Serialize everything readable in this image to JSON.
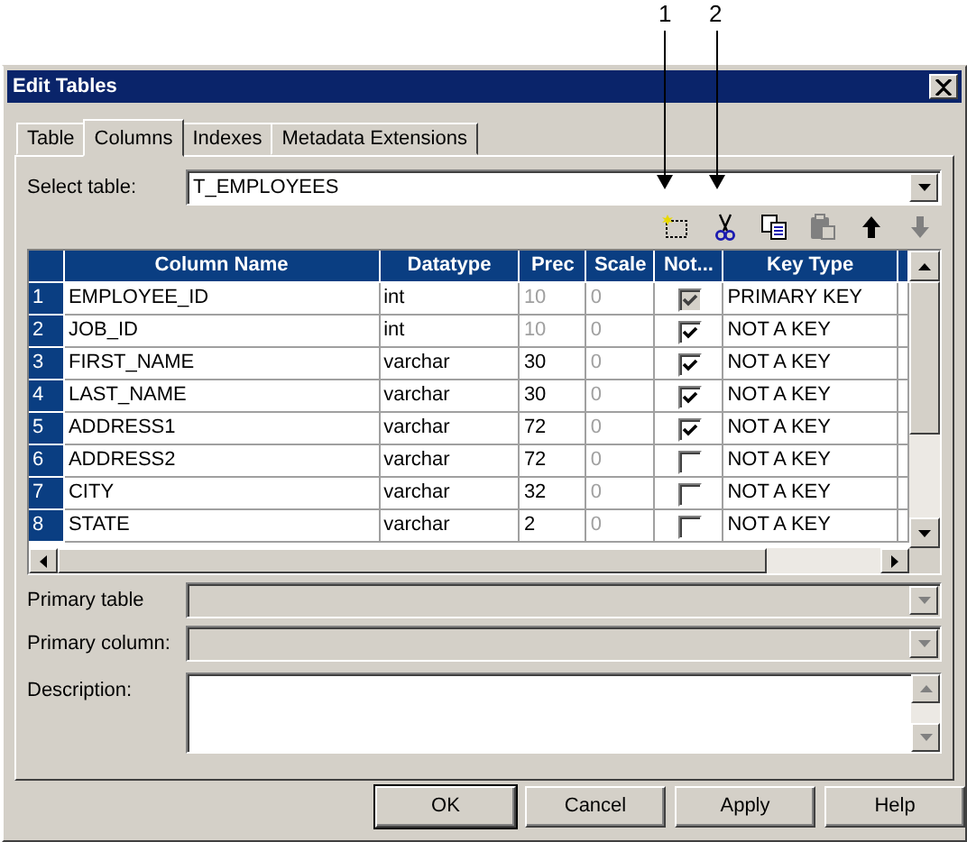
{
  "callouts": [
    {
      "label": "1"
    },
    {
      "label": "2"
    }
  ],
  "window": {
    "title": "Edit Tables"
  },
  "tabs": [
    {
      "label": "Table",
      "selected": false
    },
    {
      "label": "Columns",
      "selected": true
    },
    {
      "label": "Indexes",
      "selected": false
    },
    {
      "label": "Metadata Extensions",
      "selected": false
    }
  ],
  "select_table": {
    "label": "Select table:",
    "value": "T_EMPLOYEES"
  },
  "toolbar": [
    {
      "kind": "new",
      "disabled": false
    },
    {
      "kind": "cut",
      "disabled": false
    },
    {
      "kind": "copy",
      "disabled": false
    },
    {
      "kind": "paste",
      "disabled": true
    },
    {
      "kind": "up",
      "disabled": false
    },
    {
      "kind": "down",
      "disabled": true
    }
  ],
  "grid": {
    "columns": [
      {
        "label": "Column Name"
      },
      {
        "label": "Datatype"
      },
      {
        "label": "Prec"
      },
      {
        "label": "Scale"
      },
      {
        "label": "Not..."
      },
      {
        "label": "Key Type"
      }
    ],
    "rows": [
      {
        "number": "1",
        "name": "EMPLOYEE_ID",
        "datatype": "int",
        "prec": "10",
        "prec_disabled": true,
        "scale": "0",
        "scale_disabled": true,
        "not_null": true,
        "not_null_disabled": true,
        "key_type": "PRIMARY KEY"
      },
      {
        "number": "2",
        "name": "JOB_ID",
        "datatype": "int",
        "prec": "10",
        "prec_disabled": true,
        "scale": "0",
        "scale_disabled": true,
        "not_null": true,
        "not_null_disabled": false,
        "key_type": "NOT A KEY"
      },
      {
        "number": "3",
        "name": "FIRST_NAME",
        "datatype": "varchar",
        "prec": "30",
        "prec_disabled": false,
        "scale": "0",
        "scale_disabled": true,
        "not_null": true,
        "not_null_disabled": false,
        "key_type": "NOT A KEY"
      },
      {
        "number": "4",
        "name": "LAST_NAME",
        "datatype": "varchar",
        "prec": "30",
        "prec_disabled": false,
        "scale": "0",
        "scale_disabled": true,
        "not_null": true,
        "not_null_disabled": false,
        "key_type": "NOT A KEY"
      },
      {
        "number": "5",
        "name": "ADDRESS1",
        "datatype": "varchar",
        "prec": "72",
        "prec_disabled": false,
        "scale": "0",
        "scale_disabled": true,
        "not_null": true,
        "not_null_disabled": false,
        "key_type": "NOT A KEY"
      },
      {
        "number": "6",
        "name": "ADDRESS2",
        "datatype": "varchar",
        "prec": "72",
        "prec_disabled": false,
        "scale": "0",
        "scale_disabled": true,
        "not_null": false,
        "not_null_disabled": false,
        "key_type": "NOT A KEY"
      },
      {
        "number": "7",
        "name": "CITY",
        "datatype": "varchar",
        "prec": "32",
        "prec_disabled": false,
        "scale": "0",
        "scale_disabled": true,
        "not_null": false,
        "not_null_disabled": false,
        "key_type": "NOT A KEY"
      },
      {
        "number": "8",
        "name": "STATE",
        "datatype": "varchar",
        "prec": "2",
        "prec_disabled": false,
        "scale": "0",
        "scale_disabled": true,
        "not_null": false,
        "not_null_disabled": false,
        "key_type": "NOT A KEY"
      }
    ]
  },
  "fields": [
    {
      "label": "Primary table",
      "kind": "combo",
      "disabled": true
    },
    {
      "label": "Primary column:",
      "kind": "combo",
      "disabled": true
    },
    {
      "label": "Description:",
      "kind": "memo",
      "disabled": false
    }
  ],
  "buttons": [
    {
      "label": "OK",
      "default": true
    },
    {
      "label": "Cancel",
      "default": false
    },
    {
      "label": "Apply",
      "default": false
    },
    {
      "label": "Help",
      "default": false
    }
  ]
}
